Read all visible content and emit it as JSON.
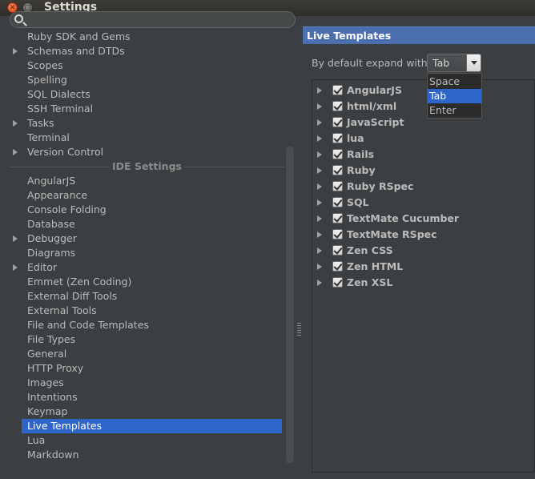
{
  "window": {
    "title": "Settings"
  },
  "left": {
    "search": {
      "placeholder": ""
    },
    "items_top": [
      {
        "label": "Ruby SDK and Gems",
        "expandable": false
      },
      {
        "label": "Schemas and DTDs",
        "expandable": true
      },
      {
        "label": "Scopes",
        "expandable": false
      },
      {
        "label": "Spelling",
        "expandable": false
      },
      {
        "label": "SQL Dialects",
        "expandable": false
      },
      {
        "label": "SSH Terminal",
        "expandable": false
      },
      {
        "label": "Tasks",
        "expandable": true
      },
      {
        "label": "Terminal",
        "expandable": false
      },
      {
        "label": "Version Control",
        "expandable": true
      }
    ],
    "ide_header": "IDE Settings",
    "items_ide": [
      {
        "label": "AngularJS",
        "expandable": false
      },
      {
        "label": "Appearance",
        "expandable": false
      },
      {
        "label": "Console Folding",
        "expandable": false
      },
      {
        "label": "Database",
        "expandable": false
      },
      {
        "label": "Debugger",
        "expandable": true
      },
      {
        "label": "Diagrams",
        "expandable": false
      },
      {
        "label": "Editor",
        "expandable": true
      },
      {
        "label": "Emmet (Zen Coding)",
        "expandable": false
      },
      {
        "label": "External Diff Tools",
        "expandable": false
      },
      {
        "label": "External Tools",
        "expandable": false
      },
      {
        "label": "File and Code Templates",
        "expandable": false
      },
      {
        "label": "File Types",
        "expandable": false
      },
      {
        "label": "General",
        "expandable": false
      },
      {
        "label": "HTTP Proxy",
        "expandable": false
      },
      {
        "label": "Images",
        "expandable": false
      },
      {
        "label": "Intentions",
        "expandable": false
      },
      {
        "label": "Keymap",
        "expandable": false
      },
      {
        "label": "Live Templates",
        "expandable": false,
        "selected": true
      },
      {
        "label": "Lua",
        "expandable": false
      },
      {
        "label": "Markdown",
        "expandable": false
      }
    ]
  },
  "right": {
    "header": "Live Templates",
    "expand_label": "By default expand with",
    "combo_value": "Tab",
    "dropdown_options": [
      "Space",
      "Tab",
      "Enter"
    ],
    "dropdown_selected": "Tab",
    "templates": [
      {
        "label": "AngularJS",
        "checked": true
      },
      {
        "label": "html/xml",
        "checked": true
      },
      {
        "label": "JavaScript",
        "checked": true
      },
      {
        "label": "lua",
        "checked": true
      },
      {
        "label": "Rails",
        "checked": true
      },
      {
        "label": "Ruby",
        "checked": true
      },
      {
        "label": "Ruby RSpec",
        "checked": true
      },
      {
        "label": "SQL",
        "checked": true
      },
      {
        "label": "TextMate Cucumber",
        "checked": true
      },
      {
        "label": "TextMate RSpec",
        "checked": true
      },
      {
        "label": "Zen CSS",
        "checked": true
      },
      {
        "label": "Zen HTML",
        "checked": true
      },
      {
        "label": "Zen XSL",
        "checked": true
      }
    ]
  },
  "colors": {
    "selection": "#2f65ca",
    "header": "#4b6eaf",
    "background": "#3c3f41"
  }
}
